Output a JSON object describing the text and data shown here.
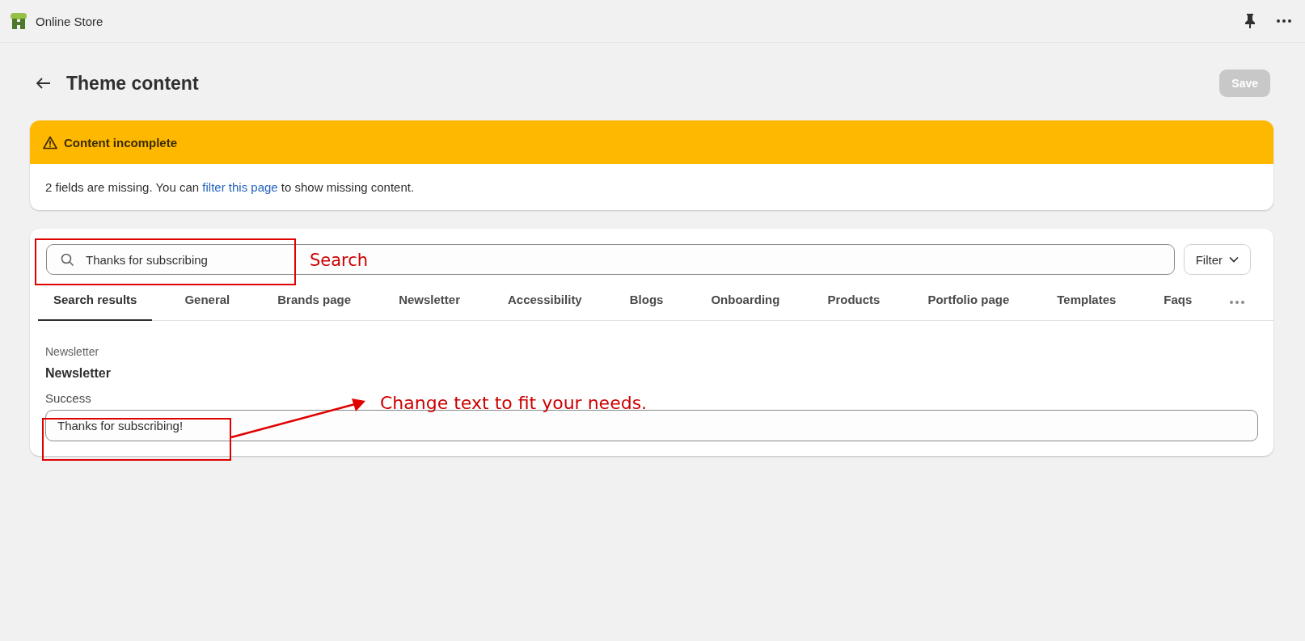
{
  "top_bar": {
    "title": "Online Store"
  },
  "header": {
    "title": "Theme content",
    "save_button": {
      "label": "Save",
      "disabled": true
    }
  },
  "banner": {
    "title": "Content incomplete",
    "message_before": "2 fields are missing. You can ",
    "link": "filter this page",
    "message_after": " to show missing content."
  },
  "search": {
    "value": "Thanks for subscribing"
  },
  "filter_button": {
    "label": "Filter"
  },
  "tabs": [
    {
      "label": "Search results",
      "selected": true
    },
    {
      "label": "General",
      "selected": false
    },
    {
      "label": "Brands page",
      "selected": false
    },
    {
      "label": "Newsletter",
      "selected": false
    },
    {
      "label": "Accessibility",
      "selected": false
    },
    {
      "label": "Blogs",
      "selected": false
    },
    {
      "label": "Onboarding",
      "selected": false
    },
    {
      "label": "Products",
      "selected": false
    },
    {
      "label": "Portfolio page",
      "selected": false
    },
    {
      "label": "Templates",
      "selected": false
    },
    {
      "label": "Faqs",
      "selected": false
    }
  ],
  "result": {
    "breadcrumb": "Newsletter",
    "section_title": "Newsletter",
    "field_label": "Success",
    "field_value": "Thanks for subscribing!"
  },
  "annotations": [
    {
      "kind": "search",
      "text": "Search"
    },
    {
      "kind": "field",
      "text": "Change text to fit your needs."
    }
  ]
}
